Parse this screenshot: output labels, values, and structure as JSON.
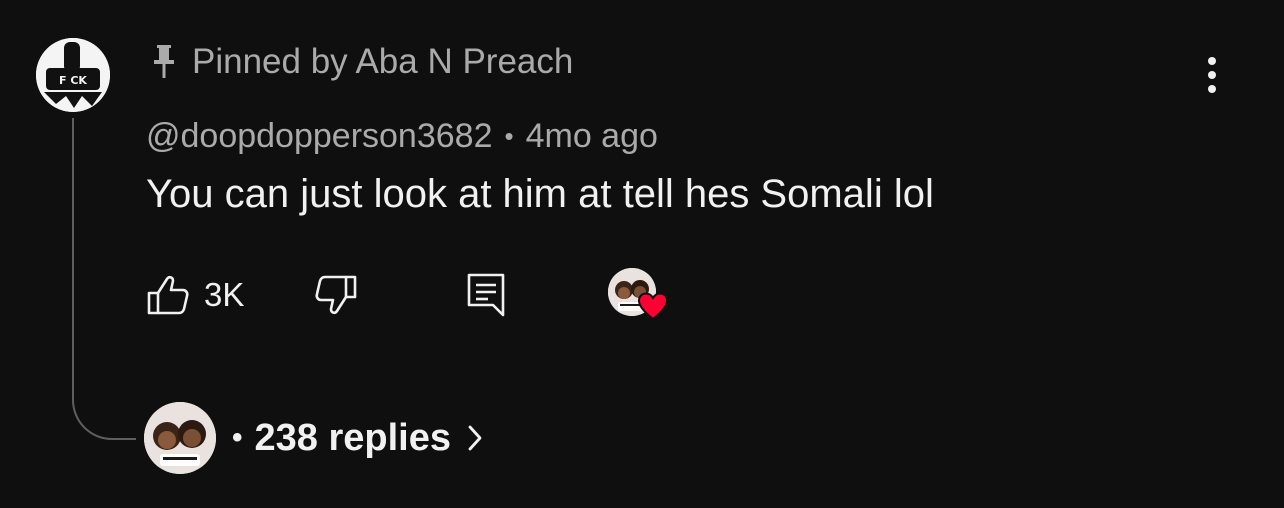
{
  "comment": {
    "pinned_text": "Pinned by Aba N Preach",
    "author": "@doopdopperson3682",
    "separator": "•",
    "time_ago": "4mo ago",
    "text": "You can just look at him at tell hes Somali lol",
    "like_count": "3K",
    "creator_hearted": true,
    "replies_separator": "•",
    "replies_label": "238 replies"
  },
  "avatar_logo_text": "F CK",
  "icons": {
    "pin": "pin-icon",
    "more": "more-vertical-icon",
    "like": "thumbs-up-icon",
    "dislike": "thumbs-down-icon",
    "reply": "comment-reply-icon",
    "heart": "heart-icon",
    "chevron": "chevron-right-icon"
  },
  "colors": {
    "background": "#0f0f0f",
    "primary_text": "#f1f1f1",
    "secondary_text": "#aaaaaa",
    "thread_line": "#5f5f5f",
    "heart": "#ff0033"
  }
}
